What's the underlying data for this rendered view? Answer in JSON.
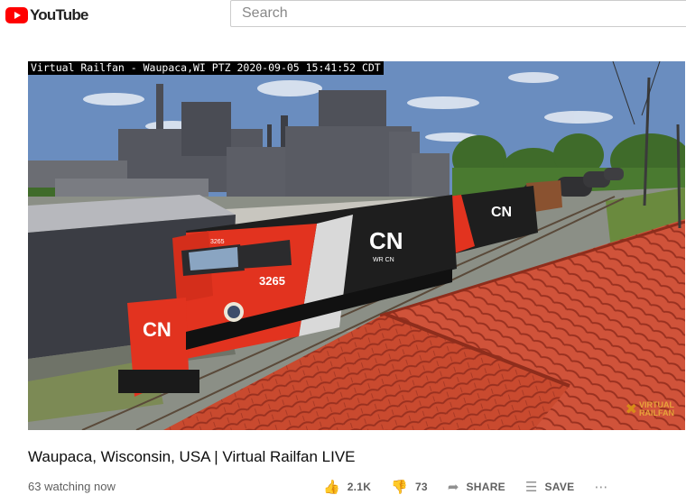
{
  "header": {
    "logo_text": "YouTube",
    "search_placeholder": "Search"
  },
  "player": {
    "camera_overlay": "Virtual Railfan - Waupaca,WI PTZ 2020-09-05 15:41:52 CDT",
    "locomotive_number": "3265",
    "locomotive_logo": "CN",
    "locomotive_logo_small": "WR CN",
    "watermark_line1": "VIRTUAL",
    "watermark_line2": "RAILFAN",
    "colors": {
      "cn_red": "#e2331f",
      "cn_black": "#1e1e1e",
      "roof_tile": "#c94a2f",
      "sky": "#6a8dbf"
    }
  },
  "video": {
    "title": "Waupaca, Wisconsin, USA | Virtual Railfan LIVE",
    "view_count": "63 watching now",
    "actions": {
      "like_count": "2.1K",
      "dislike_count": "73",
      "share_label": "SHARE",
      "save_label": "SAVE"
    },
    "icons": {
      "like": "thumbs-up-icon",
      "dislike": "thumbs-down-icon",
      "share": "share-icon",
      "save": "playlist-add-icon",
      "more": "more-icon"
    }
  }
}
